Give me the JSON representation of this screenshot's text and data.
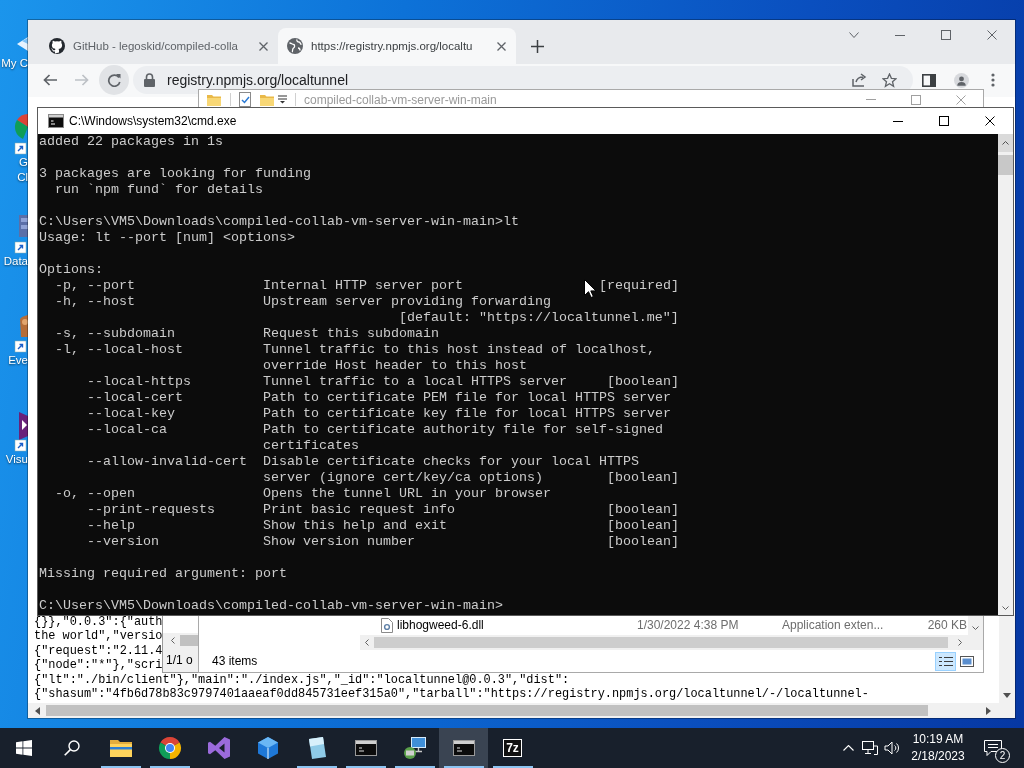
{
  "desktop": {
    "icons": [
      {
        "kind": "computer",
        "label_lines": [
          "My C"
        ]
      },
      {
        "kind": "browser",
        "label_lines": [
          "G",
          "Cl"
        ]
      },
      {
        "kind": "database",
        "label_lines": [
          "Data"
        ]
      },
      {
        "kind": "viewer",
        "label_lines": [
          "Eve"
        ]
      },
      {
        "kind": "ide",
        "label_lines": [
          "Visu"
        ]
      }
    ]
  },
  "browser": {
    "tabs": [
      {
        "kind": "github",
        "title": "GitHub - legoskid/compiled-colla",
        "selected": false
      },
      {
        "kind": "page",
        "title": "https://registry.npmjs.org/localtu",
        "selected": true
      }
    ],
    "address": "registry.npmjs.org/localtunnel",
    "page_lines": [
      "{}},\"0.0.3\":{\"auth",
      "the world\",\"versio",
      "{\"request\":\"2.11.4",
      "{\"node\":\"*\"},\"scri",
      "{\"lt\":\"./bin/client\"},\"main\":\"./index.js\",\"_id\":\"localtunnel@0.0.3\",\"dist\":",
      "{\"shasum\":\"4fb6d78b83c9797401aaeaf0dd845731eef315a0\",\"tarball\":\"https://registry.npmjs.org/localtunnel/-/localtunnel-"
    ]
  },
  "background_window": {
    "status": "1/1 o"
  },
  "explorer": {
    "title": "compiled-collab-vm-server-win-main",
    "files": [
      {
        "name": "libhogweed-6.dll",
        "modified": "1/30/2022 4:38 PM",
        "type": "Application exten...",
        "size": "260 KB"
      }
    ],
    "status": "43 items",
    "views": [
      {
        "kind": "details",
        "selected": true
      },
      {
        "kind": "large-icons",
        "selected": false
      }
    ]
  },
  "console": {
    "title": "C:\\Windows\\system32\\cmd.exe",
    "blocks": [
      [
        "added 22 packages in 1s"
      ],
      [
        "3 packages are looking for funding",
        "  run `npm fund` for details"
      ],
      [
        "C:\\Users\\VM5\\Downloads\\compiled-collab-vm-server-win-main>lt",
        "Usage: lt --port [num] <options>"
      ],
      [
        "Options:",
        "  -p, --port                Internal HTTP server port                 [required]",
        "  -h, --host                Upstream server providing forwarding",
        "                                             [default: \"https://localtunnel.me\"]",
        "  -s, --subdomain           Request this subdomain",
        "  -l, --local-host          Tunnel traffic to this host instead of localhost,",
        "                            override Host header to this host",
        "      --local-https         Tunnel traffic to a local HTTPS server     [boolean]",
        "      --local-cert          Path to certificate PEM file for local HTTPS server",
        "      --local-key           Path to certificate key file for local HTTPS server",
        "      --local-ca            Path to certificate authority file for self-signed",
        "                            certificates",
        "      --allow-invalid-cert  Disable certificate checks for your local HTTPS",
        "                            server (ignore cert/key/ca options)        [boolean]",
        "  -o, --open                Opens the tunnel URL in your browser",
        "      --print-requests      Print basic request info                   [boolean]",
        "      --help                Show this help and exit                    [boolean]",
        "      --version             Show version number                        [boolean]"
      ],
      [
        "Missing required argument: port"
      ],
      [
        "C:\\Users\\VM5\\Downloads\\compiled-collab-vm-server-win-main>"
      ]
    ]
  },
  "taskbar": {
    "apps": [
      {
        "kind": "file-explorer",
        "running": true,
        "selected": false
      },
      {
        "kind": "browser",
        "running": true,
        "selected": false
      },
      {
        "kind": "ide",
        "running": false,
        "selected": false
      },
      {
        "kind": "data-tool",
        "running": false,
        "selected": false
      },
      {
        "kind": "glass",
        "running": true,
        "selected": false
      },
      {
        "kind": "terminal",
        "running": true,
        "selected": false
      },
      {
        "kind": "network-tool",
        "running": true,
        "selected": false
      },
      {
        "kind": "terminal",
        "running": true,
        "selected": true
      },
      {
        "kind": "archiver",
        "label": "7z",
        "running": true,
        "selected": false
      }
    ],
    "time": "10:19 AM",
    "date": "2/18/2023",
    "notification_count": "2"
  }
}
